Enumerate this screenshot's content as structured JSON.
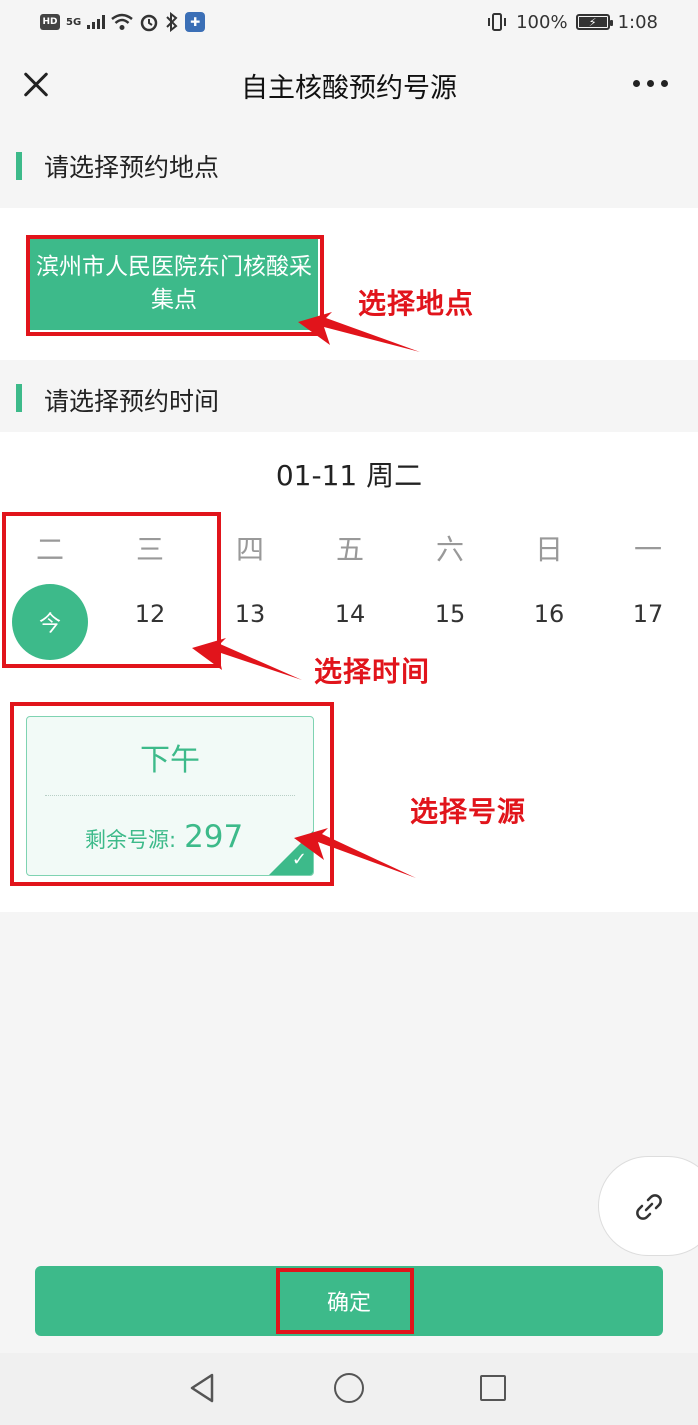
{
  "status_bar": {
    "hd": "HD",
    "network": "5G",
    "battery": "100%",
    "time": "1:08",
    "icons": [
      "hd-icon",
      "signal-icon",
      "wifi-icon",
      "alarm-icon",
      "bluetooth-icon",
      "app-notification-icon",
      "vibrate-icon",
      "battery-icon"
    ]
  },
  "nav": {
    "title": "自主核酸预约号源",
    "close_icon": "close-icon",
    "more_icon": "more-icon"
  },
  "location_section": {
    "header": "请选择预约地点",
    "options": [
      {
        "label": "滨州市人民医院东门核酸采集点",
        "selected": true
      }
    ]
  },
  "time_section": {
    "header": "请选择预约时间",
    "current_date": "01-11 周二",
    "weekdays": [
      "二",
      "三",
      "四",
      "五",
      "六",
      "日",
      "一"
    ],
    "days": [
      "今",
      "12",
      "13",
      "14",
      "15",
      "16",
      "17"
    ],
    "selected_index": 0
  },
  "slot": {
    "period": "下午",
    "remaining_label": "剩余号源:",
    "remaining_count": "297",
    "selected": true
  },
  "annotations": {
    "location": "选择地点",
    "time": "选择时间",
    "slot": "选择号源"
  },
  "confirm_button": "确定",
  "float_button_icon": "link-icon",
  "colors": {
    "accent": "#3dba8a",
    "annotation": "#e1141b"
  }
}
